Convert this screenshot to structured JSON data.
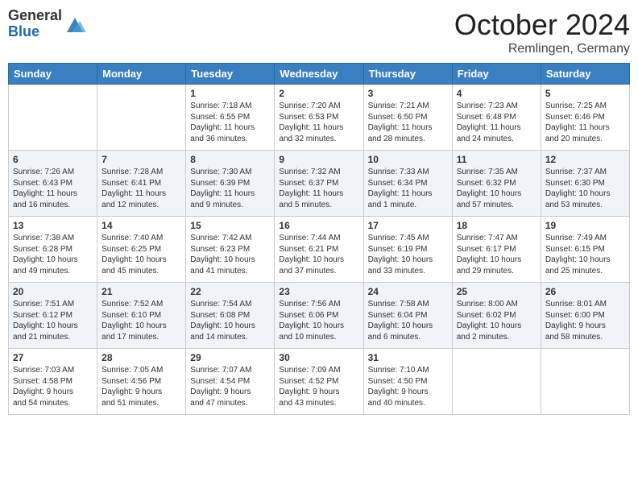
{
  "header": {
    "logo_general": "General",
    "logo_blue": "Blue",
    "month": "October 2024",
    "location": "Remlingen, Germany"
  },
  "weekdays": [
    "Sunday",
    "Monday",
    "Tuesday",
    "Wednesday",
    "Thursday",
    "Friday",
    "Saturday"
  ],
  "weeks": [
    [
      {
        "day": "",
        "info": ""
      },
      {
        "day": "",
        "info": ""
      },
      {
        "day": "1",
        "info": "Sunrise: 7:18 AM\nSunset: 6:55 PM\nDaylight: 11 hours\nand 36 minutes."
      },
      {
        "day": "2",
        "info": "Sunrise: 7:20 AM\nSunset: 6:53 PM\nDaylight: 11 hours\nand 32 minutes."
      },
      {
        "day": "3",
        "info": "Sunrise: 7:21 AM\nSunset: 6:50 PM\nDaylight: 11 hours\nand 28 minutes."
      },
      {
        "day": "4",
        "info": "Sunrise: 7:23 AM\nSunset: 6:48 PM\nDaylight: 11 hours\nand 24 minutes."
      },
      {
        "day": "5",
        "info": "Sunrise: 7:25 AM\nSunset: 6:46 PM\nDaylight: 11 hours\nand 20 minutes."
      }
    ],
    [
      {
        "day": "6",
        "info": "Sunrise: 7:26 AM\nSunset: 6:43 PM\nDaylight: 11 hours\nand 16 minutes."
      },
      {
        "day": "7",
        "info": "Sunrise: 7:28 AM\nSunset: 6:41 PM\nDaylight: 11 hours\nand 12 minutes."
      },
      {
        "day": "8",
        "info": "Sunrise: 7:30 AM\nSunset: 6:39 PM\nDaylight: 11 hours\nand 9 minutes."
      },
      {
        "day": "9",
        "info": "Sunrise: 7:32 AM\nSunset: 6:37 PM\nDaylight: 11 hours\nand 5 minutes."
      },
      {
        "day": "10",
        "info": "Sunrise: 7:33 AM\nSunset: 6:34 PM\nDaylight: 11 hours\nand 1 minute."
      },
      {
        "day": "11",
        "info": "Sunrise: 7:35 AM\nSunset: 6:32 PM\nDaylight: 10 hours\nand 57 minutes."
      },
      {
        "day": "12",
        "info": "Sunrise: 7:37 AM\nSunset: 6:30 PM\nDaylight: 10 hours\nand 53 minutes."
      }
    ],
    [
      {
        "day": "13",
        "info": "Sunrise: 7:38 AM\nSunset: 6:28 PM\nDaylight: 10 hours\nand 49 minutes."
      },
      {
        "day": "14",
        "info": "Sunrise: 7:40 AM\nSunset: 6:25 PM\nDaylight: 10 hours\nand 45 minutes."
      },
      {
        "day": "15",
        "info": "Sunrise: 7:42 AM\nSunset: 6:23 PM\nDaylight: 10 hours\nand 41 minutes."
      },
      {
        "day": "16",
        "info": "Sunrise: 7:44 AM\nSunset: 6:21 PM\nDaylight: 10 hours\nand 37 minutes."
      },
      {
        "day": "17",
        "info": "Sunrise: 7:45 AM\nSunset: 6:19 PM\nDaylight: 10 hours\nand 33 minutes."
      },
      {
        "day": "18",
        "info": "Sunrise: 7:47 AM\nSunset: 6:17 PM\nDaylight: 10 hours\nand 29 minutes."
      },
      {
        "day": "19",
        "info": "Sunrise: 7:49 AM\nSunset: 6:15 PM\nDaylight: 10 hours\nand 25 minutes."
      }
    ],
    [
      {
        "day": "20",
        "info": "Sunrise: 7:51 AM\nSunset: 6:12 PM\nDaylight: 10 hours\nand 21 minutes."
      },
      {
        "day": "21",
        "info": "Sunrise: 7:52 AM\nSunset: 6:10 PM\nDaylight: 10 hours\nand 17 minutes."
      },
      {
        "day": "22",
        "info": "Sunrise: 7:54 AM\nSunset: 6:08 PM\nDaylight: 10 hours\nand 14 minutes."
      },
      {
        "day": "23",
        "info": "Sunrise: 7:56 AM\nSunset: 6:06 PM\nDaylight: 10 hours\nand 10 minutes."
      },
      {
        "day": "24",
        "info": "Sunrise: 7:58 AM\nSunset: 6:04 PM\nDaylight: 10 hours\nand 6 minutes."
      },
      {
        "day": "25",
        "info": "Sunrise: 8:00 AM\nSunset: 6:02 PM\nDaylight: 10 hours\nand 2 minutes."
      },
      {
        "day": "26",
        "info": "Sunrise: 8:01 AM\nSunset: 6:00 PM\nDaylight: 9 hours\nand 58 minutes."
      }
    ],
    [
      {
        "day": "27",
        "info": "Sunrise: 7:03 AM\nSunset: 4:58 PM\nDaylight: 9 hours\nand 54 minutes."
      },
      {
        "day": "28",
        "info": "Sunrise: 7:05 AM\nSunset: 4:56 PM\nDaylight: 9 hours\nand 51 minutes."
      },
      {
        "day": "29",
        "info": "Sunrise: 7:07 AM\nSunset: 4:54 PM\nDaylight: 9 hours\nand 47 minutes."
      },
      {
        "day": "30",
        "info": "Sunrise: 7:09 AM\nSunset: 4:52 PM\nDaylight: 9 hours\nand 43 minutes."
      },
      {
        "day": "31",
        "info": "Sunrise: 7:10 AM\nSunset: 4:50 PM\nDaylight: 9 hours\nand 40 minutes."
      },
      {
        "day": "",
        "info": ""
      },
      {
        "day": "",
        "info": ""
      }
    ]
  ]
}
